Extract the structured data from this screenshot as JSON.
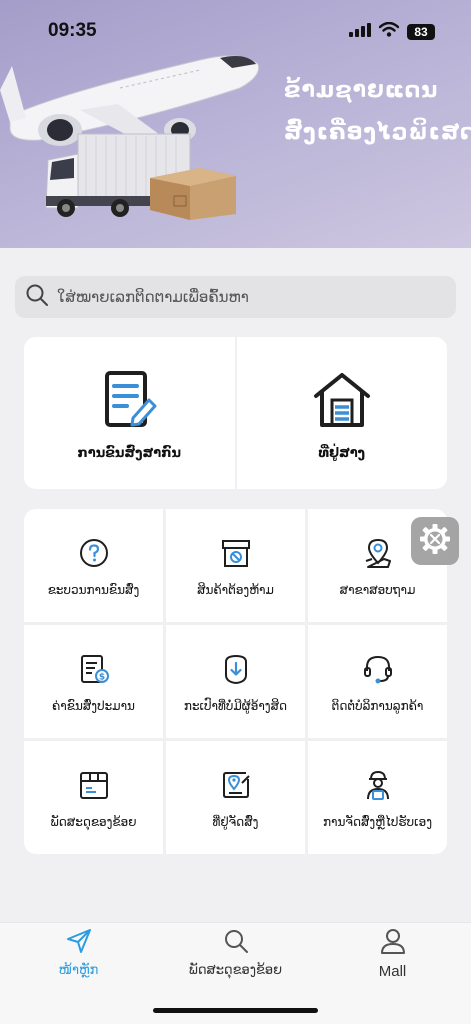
{
  "status_bar": {
    "time": "09:35",
    "battery": "83",
    "icons": [
      "cellular-icon",
      "wifi-icon",
      "battery-icon"
    ]
  },
  "hero": {
    "line1": "ຂ້າມຊາຍແດນ",
    "line2": "ສົ່ງເຄື່ອງໄວພິເສດ"
  },
  "search": {
    "placeholder": "ໃສ່ໝາຍເລກຕິດຕາມເພື່ອຄົ້ນຫາ",
    "icon": "search-icon"
  },
  "top_cards": [
    {
      "label": "ການຂົນສົ່ງສາກົນ",
      "icon": "document-edit-icon"
    },
    {
      "label": "ທີ່ຢູ່ສາງ",
      "icon": "warehouse-icon"
    }
  ],
  "grid": [
    {
      "label": "ຂະບວນການຂົນສົ່ງ",
      "icon": "question-circle-icon"
    },
    {
      "label": "ສິນຄ້າຕ້ອງຫ້າມ",
      "icon": "prohibited-box-icon"
    },
    {
      "label": "ສາຂາສອບຖາມ",
      "icon": "location-pin-icon"
    },
    {
      "label": "ຄ່າຂົນສົ່ງປະມານ",
      "icon": "fee-document-icon"
    },
    {
      "label": "ກະເປົາທີ່ບໍ່ມີຜູ້ອ້າງສິດ",
      "icon": "unclaimed-bag-icon"
    },
    {
      "label": "ຕິດຕໍ່ບໍລິການລູກຄ້າ",
      "icon": "headset-icon"
    },
    {
      "label": "ພັດສະດຸຂອງຂ້ອຍ",
      "icon": "parcel-box-icon"
    },
    {
      "label": "ທີ່ຢູ່ຈັດສົ່ງ",
      "icon": "delivery-address-icon"
    },
    {
      "label": "ການຈັດສົ່ງຫຼືໄປຮັບເອງ",
      "icon": "courier-icon"
    }
  ],
  "floating_button": {
    "icon": "settings-gear-icon"
  },
  "tabbar": [
    {
      "label": "ໜ້າຫຼັກ",
      "icon": "send-icon",
      "active": true
    },
    {
      "label": "ພັດສະດຸຂອງຂ້ອຍ",
      "icon": "search-icon",
      "active": false
    },
    {
      "label": "Mall",
      "icon": "person-icon",
      "active": false
    }
  ],
  "colors": {
    "accent": "#2d9be0",
    "icon_dark": "#1f1f1f",
    "icon_blue": "#3a8fd8",
    "hero_bg": "#b7b1d6"
  }
}
